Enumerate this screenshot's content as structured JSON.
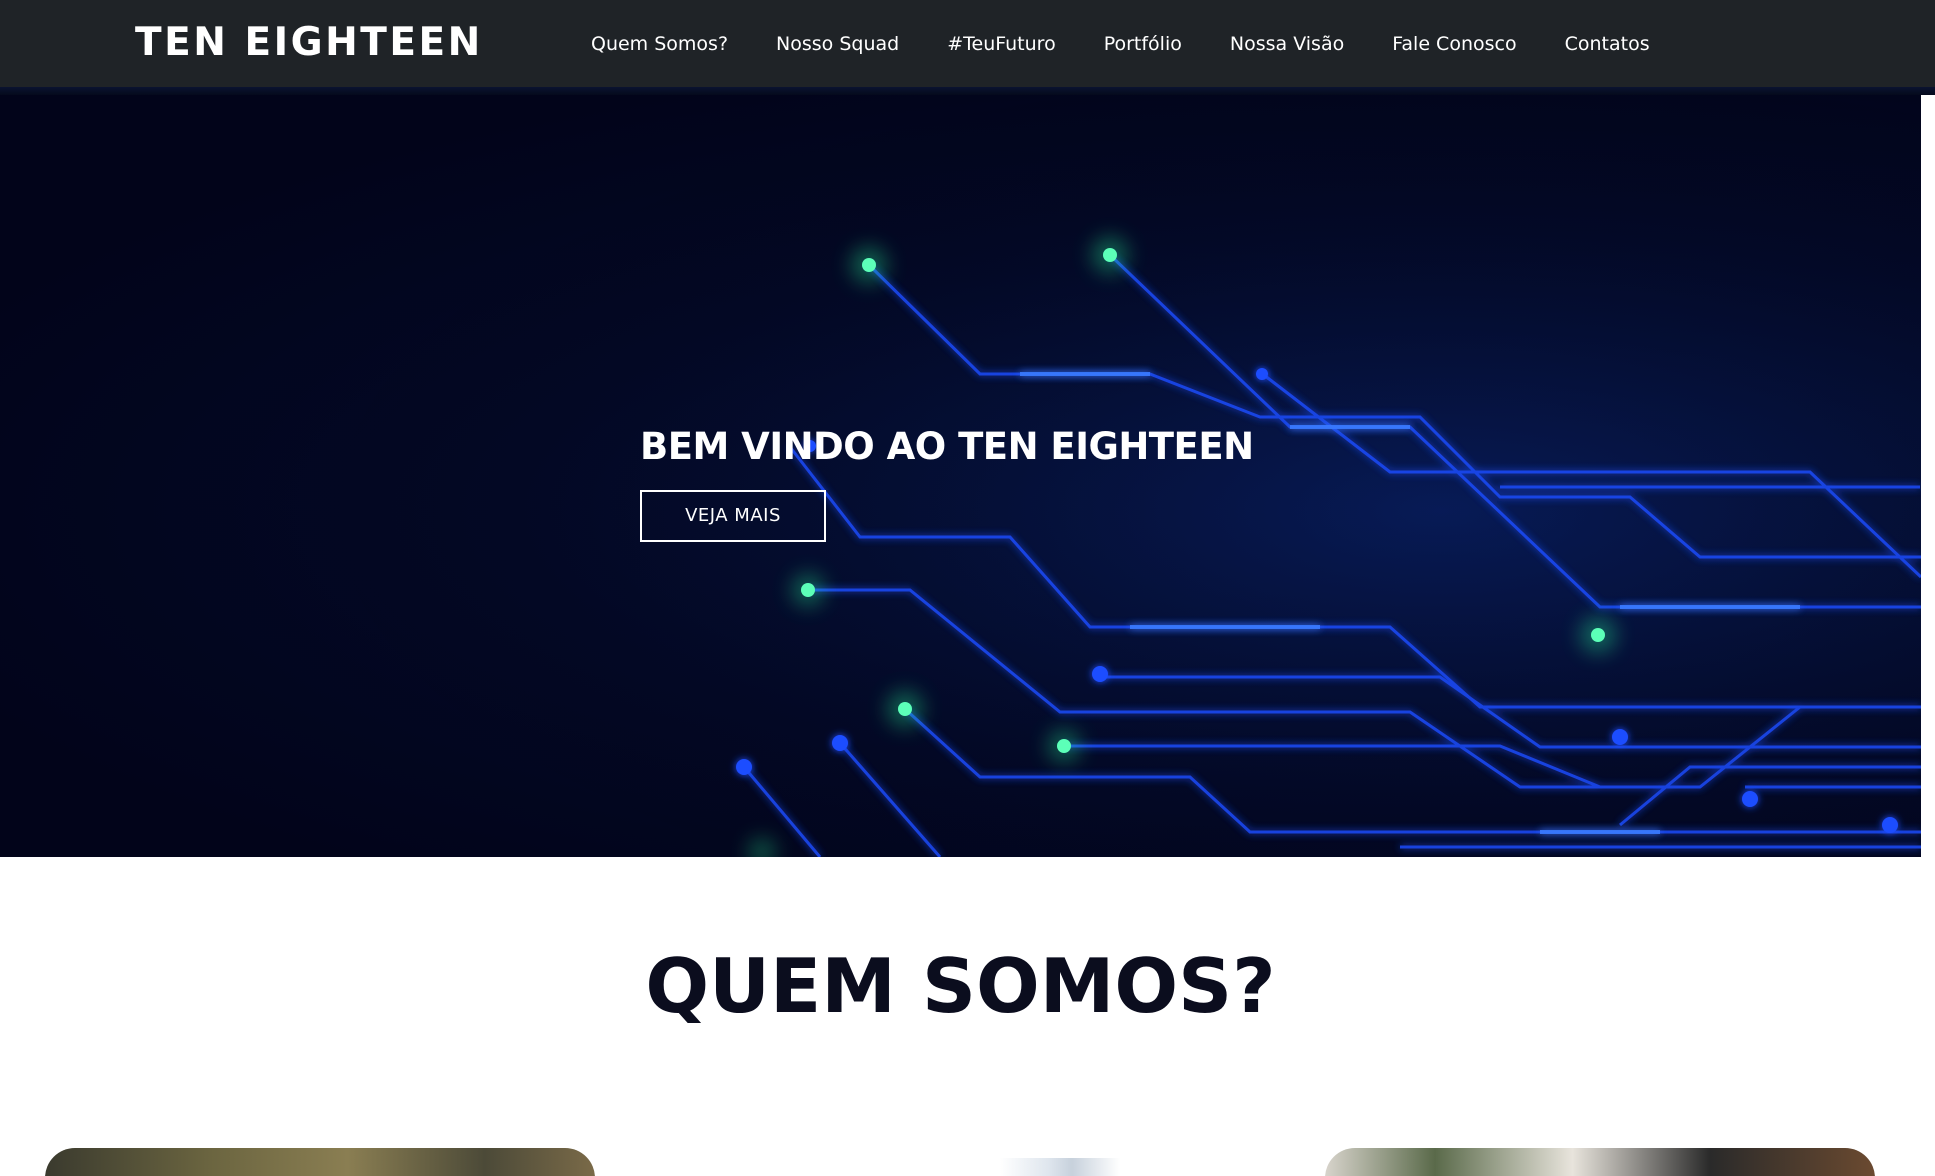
{
  "navbar": {
    "brand": "TEN EIGHTEEN",
    "links": [
      "Quem Somos?",
      "Nosso Squad",
      "#TeuFuturo",
      "Portfólio",
      "Nossa Visão",
      "Fale Conosco",
      "Contatos"
    ]
  },
  "hero": {
    "title": "BEM VINDO AO TEN EIGHTEEN",
    "button_label": "VEJA MAIS",
    "background": "circuit-board-image"
  },
  "about": {
    "title": "QUEM SOMOS?"
  },
  "colors": {
    "navbar_bg": "#1f2327",
    "hero_bg": "#02041a",
    "circuit_line": "#1d4dff",
    "circuit_glow": "#3cffb0",
    "heading_dark": "#0b0d1e"
  }
}
